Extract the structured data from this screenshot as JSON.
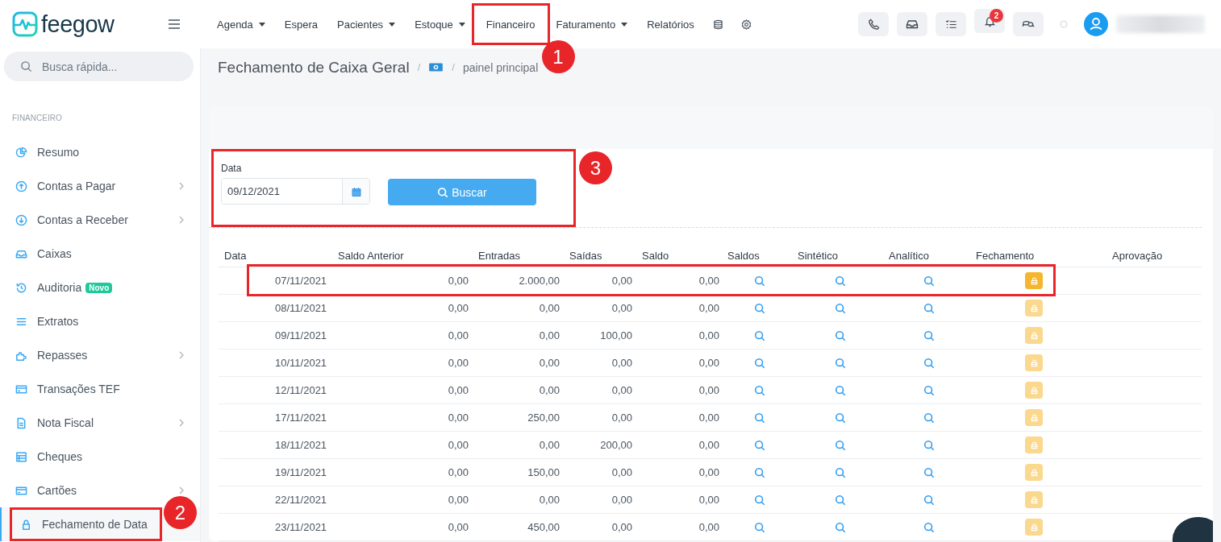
{
  "app": {
    "logo_text": "feegow"
  },
  "nav": [
    {
      "label": "Agenda",
      "dropdown": true
    },
    {
      "label": "Espera",
      "dropdown": false
    },
    {
      "label": "Pacientes",
      "dropdown": true
    },
    {
      "label": "Estoque",
      "dropdown": true
    },
    {
      "label": "Financeiro",
      "dropdown": false,
      "callout": "1"
    },
    {
      "label": "Faturamento",
      "dropdown": true
    },
    {
      "label": "Relatórios",
      "dropdown": false
    }
  ],
  "notifications": {
    "count": "2"
  },
  "search": {
    "placeholder": "Busca rápida..."
  },
  "sidebar": {
    "section": "FINANCEIRO",
    "items": [
      {
        "label": "Resumo",
        "submenu": false,
        "selected": false
      },
      {
        "label": "Contas a Pagar",
        "submenu": true,
        "selected": false
      },
      {
        "label": "Contas a Receber",
        "submenu": true,
        "selected": false
      },
      {
        "label": "Caixas",
        "submenu": false,
        "selected": false
      },
      {
        "label": "Auditoria",
        "submenu": false,
        "selected": false,
        "badge": "Novo"
      },
      {
        "label": "Extratos",
        "submenu": false,
        "selected": false
      },
      {
        "label": "Repasses",
        "submenu": true,
        "selected": false
      },
      {
        "label": "Transações TEF",
        "submenu": false,
        "selected": false
      },
      {
        "label": "Nota Fiscal",
        "submenu": true,
        "selected": false
      },
      {
        "label": "Cheques",
        "submenu": false,
        "selected": false
      },
      {
        "label": "Cartões",
        "submenu": true,
        "selected": false
      },
      {
        "label": "Fechamento de Data",
        "submenu": false,
        "selected": true,
        "callout": "2"
      }
    ]
  },
  "breadcrumb": {
    "title": "Fechamento de Caixa Geral",
    "separator": "/",
    "current": "painel principal"
  },
  "filter": {
    "label": "Data",
    "value": "09/12/2021",
    "button": "Buscar",
    "callout": "3"
  },
  "table": {
    "columns": [
      "Data",
      "Saldo Anterior",
      "Entradas",
      "Saídas",
      "Saldo",
      "Saldos",
      "Sintético",
      "Analítico",
      "Fechamento",
      "Aprovação"
    ],
    "rows": [
      {
        "date": "07/11/2021",
        "saldo_anterior": "0,00",
        "entradas": "2.000,00",
        "saidas": "0,00",
        "saldo": "0,00",
        "lock_enabled": true,
        "highlighted": true
      },
      {
        "date": "08/11/2021",
        "saldo_anterior": "0,00",
        "entradas": "0,00",
        "saidas": "0,00",
        "saldo": "0,00",
        "lock_enabled": false,
        "highlighted": false
      },
      {
        "date": "09/11/2021",
        "saldo_anterior": "0,00",
        "entradas": "0,00",
        "saidas": "100,00",
        "saldo": "0,00",
        "lock_enabled": false,
        "highlighted": false
      },
      {
        "date": "10/11/2021",
        "saldo_anterior": "0,00",
        "entradas": "0,00",
        "saidas": "0,00",
        "saldo": "0,00",
        "lock_enabled": false,
        "highlighted": false
      },
      {
        "date": "12/11/2021",
        "saldo_anterior": "0,00",
        "entradas": "0,00",
        "saidas": "0,00",
        "saldo": "0,00",
        "lock_enabled": false,
        "highlighted": false
      },
      {
        "date": "17/11/2021",
        "saldo_anterior": "0,00",
        "entradas": "250,00",
        "saidas": "0,00",
        "saldo": "0,00",
        "lock_enabled": false,
        "highlighted": false
      },
      {
        "date": "18/11/2021",
        "saldo_anterior": "0,00",
        "entradas": "0,00",
        "saidas": "200,00",
        "saldo": "0,00",
        "lock_enabled": false,
        "highlighted": false
      },
      {
        "date": "19/11/2021",
        "saldo_anterior": "0,00",
        "entradas": "150,00",
        "saidas": "0,00",
        "saldo": "0,00",
        "lock_enabled": false,
        "highlighted": false
      },
      {
        "date": "22/11/2021",
        "saldo_anterior": "0,00",
        "entradas": "0,00",
        "saidas": "0,00",
        "saldo": "0,00",
        "lock_enabled": false,
        "highlighted": false
      },
      {
        "date": "23/11/2021",
        "saldo_anterior": "0,00",
        "entradas": "450,00",
        "saidas": "0,00",
        "saldo": "0,00",
        "lock_enabled": false,
        "highlighted": false
      }
    ]
  }
}
